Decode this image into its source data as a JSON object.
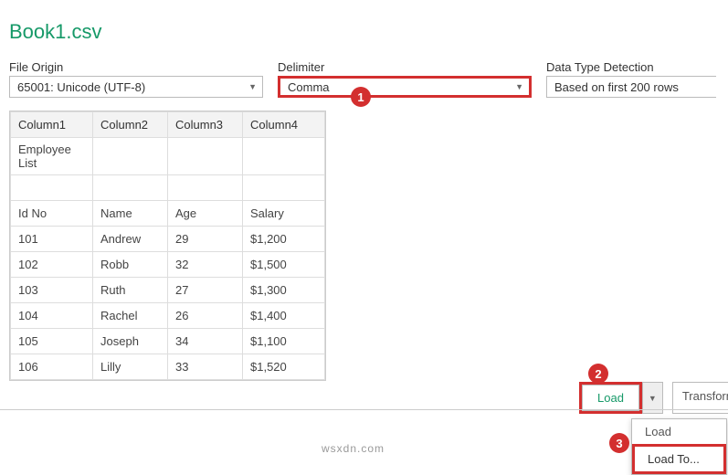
{
  "title": "Book1.csv",
  "controls": {
    "file_origin_label": "File Origin",
    "file_origin_value": "65001: Unicode (UTF-8)",
    "delimiter_label": "Delimiter",
    "delimiter_value": "Comma",
    "detection_label": "Data Type Detection",
    "detection_value": "Based on first 200 rows"
  },
  "columns": [
    "Column1",
    "Column2",
    "Column3",
    "Column4"
  ],
  "rows": [
    [
      "Employee List",
      "",
      "",
      ""
    ],
    [
      "",
      "",
      "",
      ""
    ],
    [
      "Id No",
      "Name",
      "Age",
      "Salary"
    ],
    [
      "101",
      "Andrew",
      "29",
      "$1,200"
    ],
    [
      "102",
      "Robb",
      "32",
      "$1,500"
    ],
    [
      "103",
      "Ruth",
      "27",
      "$1,300"
    ],
    [
      "104",
      "Rachel",
      "26",
      "$1,400"
    ],
    [
      "105",
      "Joseph",
      "34",
      "$1,100"
    ],
    [
      "106",
      "Lilly",
      "33",
      "$1,520"
    ]
  ],
  "buttons": {
    "load": "Load",
    "transform": "Transform",
    "menu_load": "Load",
    "menu_load_to": "Load To..."
  },
  "badges": {
    "b1": "1",
    "b2": "2",
    "b3": "3"
  },
  "watermark": "wsxdn.com"
}
